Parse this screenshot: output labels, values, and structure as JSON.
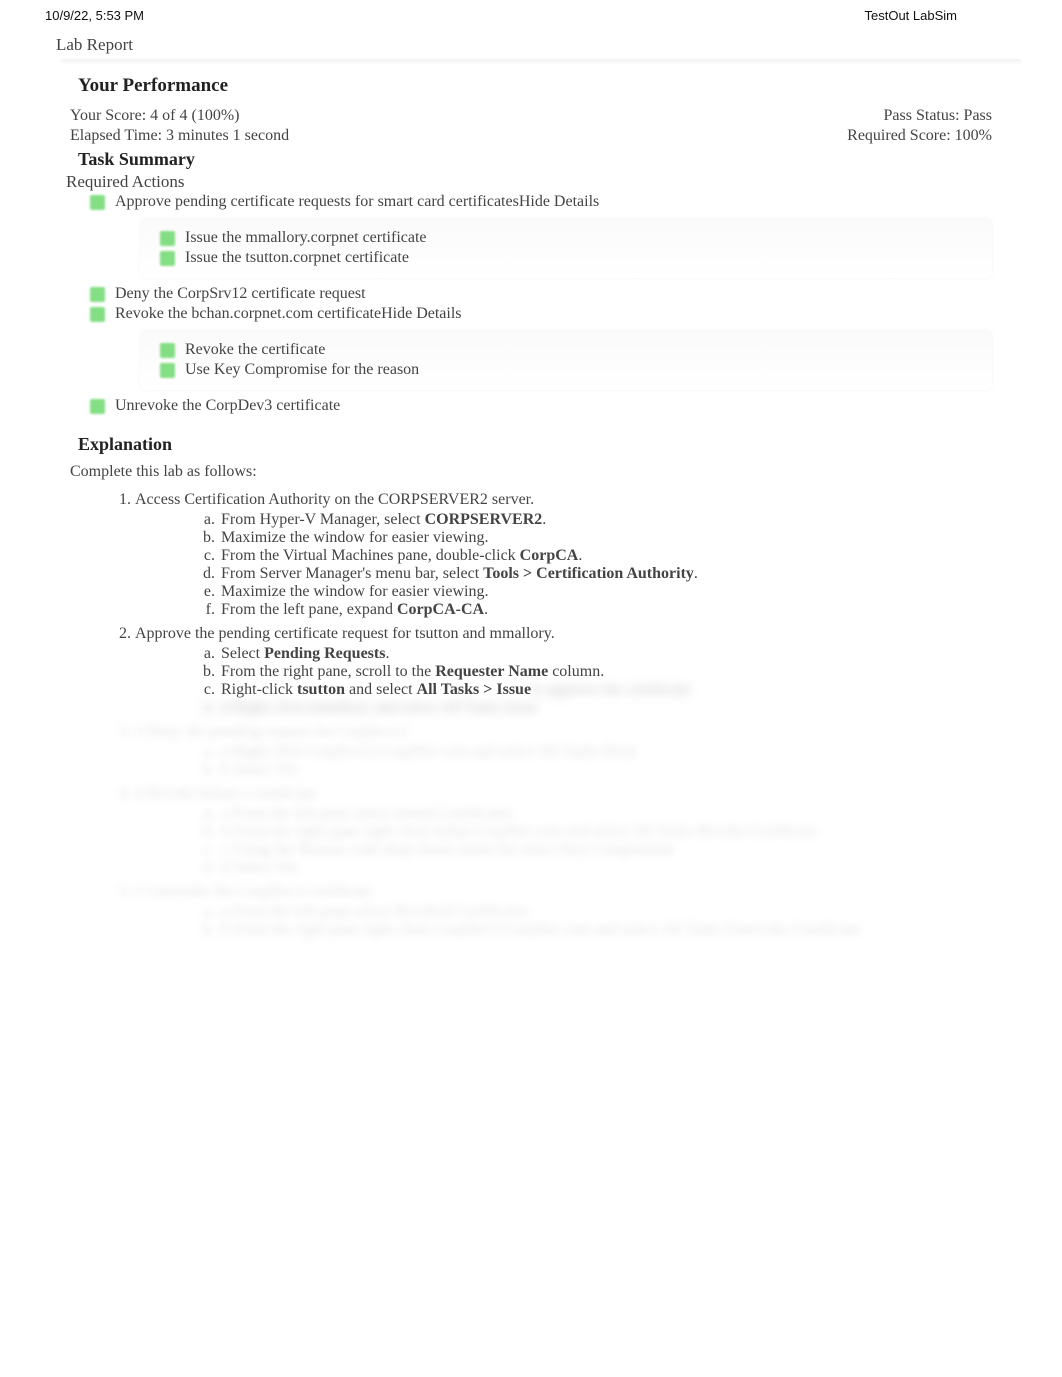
{
  "header": {
    "timestamp": "10/9/22, 5:53 PM",
    "product": "TestOut LabSim"
  },
  "title": "Lab Report",
  "performance": {
    "heading": "Your Performance",
    "score_label": "Your Score: 4 of 4 (100%)",
    "pass_status": "Pass Status: Pass",
    "elapsed": "Elapsed Time: 3 minutes 1 second",
    "required_score": "Required Score: 100%"
  },
  "task_summary": {
    "heading": "Task Summary",
    "required_actions": "Required Actions",
    "items": [
      {
        "text": "Approve pending certificate requests for smart card certificates",
        "hide": "Hide Details",
        "subs": [
          "Issue the mmallory.corpnet certificate",
          "Issue the tsutton.corpnet certificate"
        ]
      },
      {
        "text": "Deny the CorpSrv12 certificate request"
      },
      {
        "text": "Revoke the bchan.corpnet.com certificate",
        "hide": "Hide Details",
        "subs": [
          "Revoke the certificate",
          "Use Key Compromise for the reason"
        ]
      },
      {
        "text": "Unrevoke the CorpDev3 certificate"
      }
    ]
  },
  "explanation": {
    "heading": "Explanation",
    "intro": "Complete this lab as follows:",
    "steps": [
      {
        "title": "Access Certification Authority on the CORPSERVER2 server.",
        "sub": [
          {
            "pre": "From Hyper-V Manager, select ",
            "bold": "CORPSERVER2",
            "post": "."
          },
          {
            "pre": "Maximize the window for easier viewing.",
            "bold": "",
            "post": ""
          },
          {
            "pre": "From the Virtual Machines pane, double-click ",
            "bold": "CorpCA",
            "post": "."
          },
          {
            "pre": "From Server Manager's menu bar, select ",
            "bold": "Tools > Certification Authority",
            "post": "."
          },
          {
            "pre": "Maximize the window for easier viewing.",
            "bold": "",
            "post": ""
          },
          {
            "pre": "From the left pane, expand ",
            "bold": "CorpCA-CA",
            "post": "."
          }
        ]
      },
      {
        "title": "Approve the pending certificate request for tsutton and mmallory.",
        "sub": [
          {
            "pre": "Select ",
            "bold": "Pending Requests",
            "post": "."
          },
          {
            "pre": "From the right pane, scroll to the ",
            "bold": "Requester Name",
            "post": " column."
          },
          {
            "pre": "Right-click ",
            "bold": "tsutton",
            "mid": " and select ",
            "bold2": "All Tasks > Issue",
            "post": ""
          }
        ]
      }
    ],
    "blurred": [
      "to approve the certificate",
      "d Right click mmallory and select All Tasks Issue",
      "3 Deny the pending request for CorpSrv12",
      "a Right click CorpSrv12 CorpNet com and select All Tasks Deny",
      "b Select Yes",
      "4 Revoke bchan s certificate",
      "a From the left pane select Issued Certificates",
      "b From the right pane right click bchan CorpNet com and select All Tasks Revoke Certificate",
      "c Using the Reason code drop-down menu list select Key Compromise",
      "d Select Yes",
      "5 Unrevoke the CorpDev3 certificate",
      "a From the left pane select Revoked Certificates",
      "b From the right pane right click CorpDev3 CorpNet com and select All Tasks Unrevoke Certificate"
    ]
  }
}
